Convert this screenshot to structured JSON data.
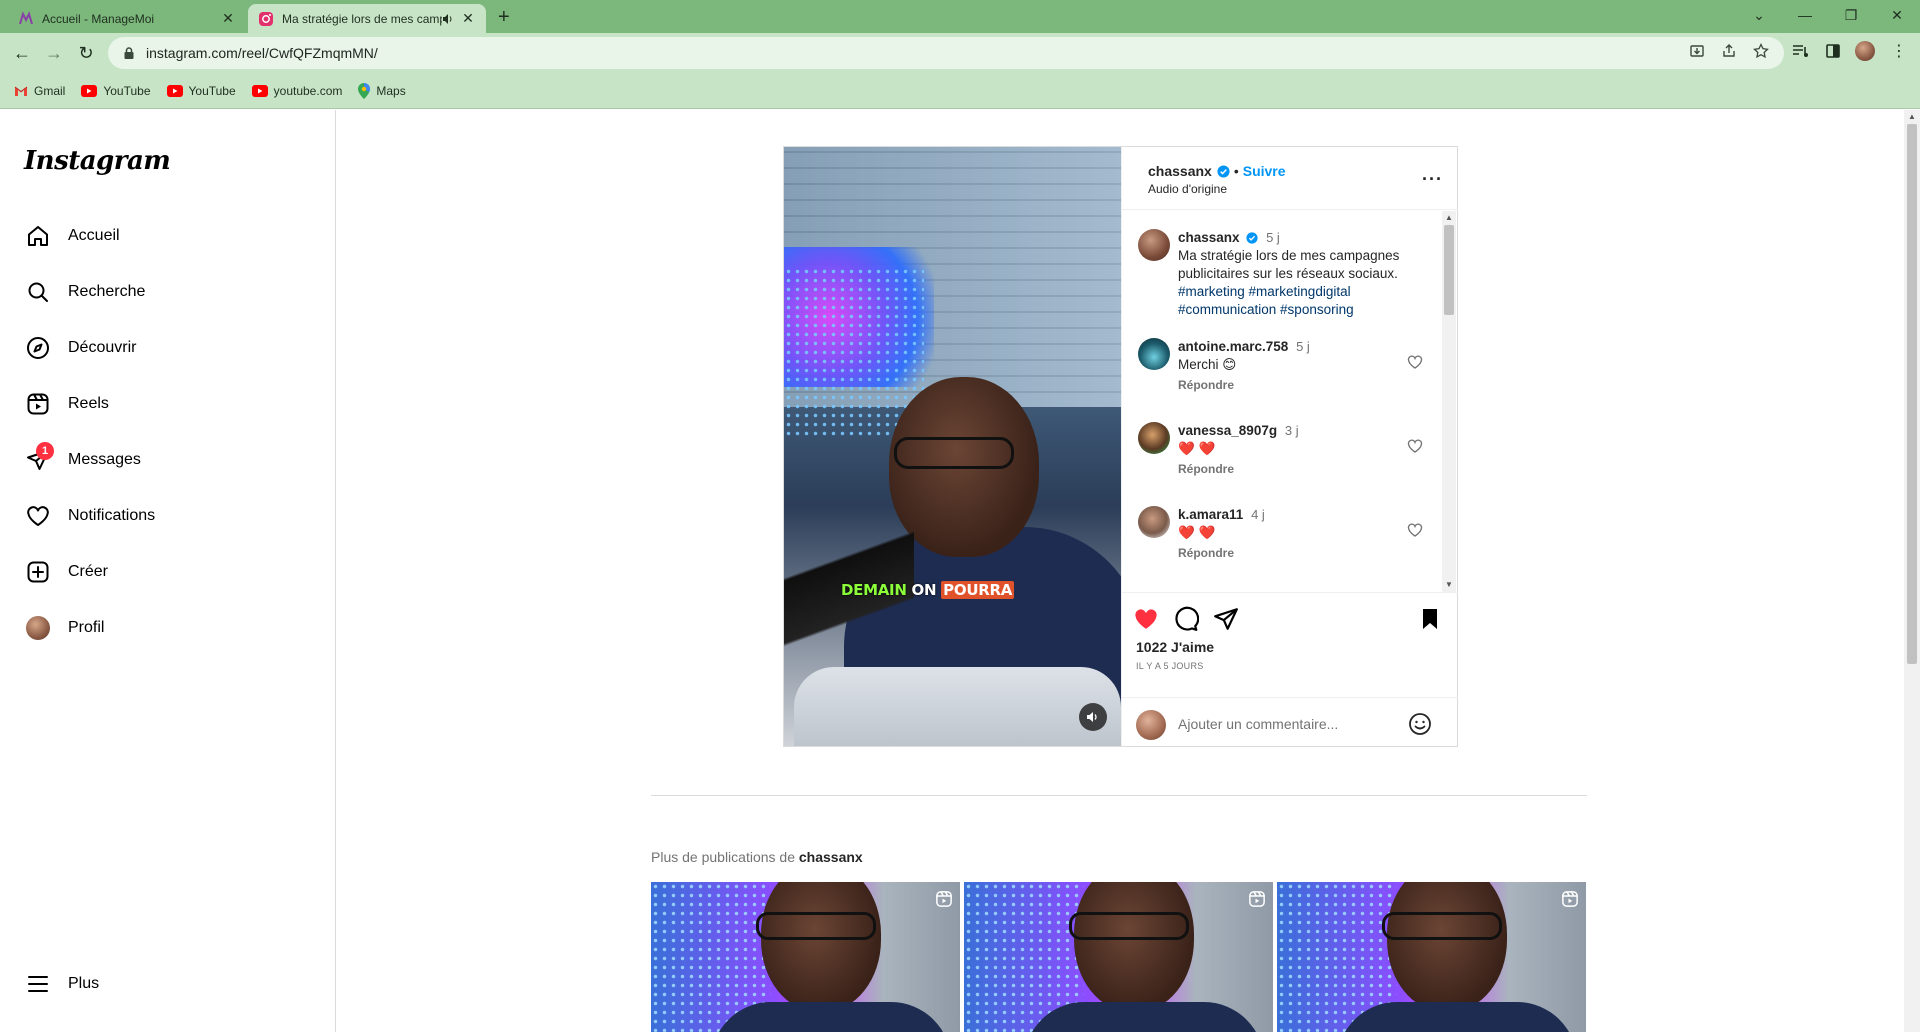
{
  "browser": {
    "tabs": [
      {
        "title": "Accueil - ManageMoi",
        "active": false
      },
      {
        "title": "Ma stratégie lors de mes campagnes",
        "active": true
      }
    ],
    "url": "instagram.com/reel/CwfQFZmqmMN/",
    "bookmarks": [
      {
        "label": "Gmail",
        "icon": "gmail-icon"
      },
      {
        "label": "YouTube",
        "icon": "youtube-icon"
      },
      {
        "label": "YouTube",
        "icon": "youtube-icon"
      },
      {
        "label": "youtube.com",
        "icon": "youtube-icon"
      },
      {
        "label": "Maps",
        "icon": "maps-icon"
      }
    ]
  },
  "sidebar": {
    "logo": "Instagram",
    "items": [
      {
        "label": "Accueil",
        "icon": "home-icon"
      },
      {
        "label": "Recherche",
        "icon": "search-icon"
      },
      {
        "label": "Découvrir",
        "icon": "compass-icon"
      },
      {
        "label": "Reels",
        "icon": "reels-icon"
      },
      {
        "label": "Messages",
        "icon": "messenger-icon",
        "badge": "1"
      },
      {
        "label": "Notifications",
        "icon": "heart-icon"
      },
      {
        "label": "Créer",
        "icon": "plus-square-icon"
      },
      {
        "label": "Profil",
        "icon": "avatar"
      }
    ],
    "more": "Plus"
  },
  "post": {
    "author": "chassanx",
    "follow": "Suivre",
    "audio": "Audio d'origine",
    "video_caption": {
      "part1": "DEMAIN",
      "part2": "ON",
      "part3": "POURRA"
    },
    "caption": {
      "username": "chassanx",
      "time": "5 j",
      "text": "Ma stratégie lors de mes campagnes publicitaires sur les réseaux sociaux.",
      "hashtags": "#marketing #marketingdigital #communication #sponsoring"
    },
    "comments": [
      {
        "username": "antoine.marc.758",
        "time": "5 j",
        "text": "Merchi 😊",
        "reply": "Répondre"
      },
      {
        "username": "vanessa_8907g",
        "time": "3 j",
        "text": "❤️ ❤️",
        "reply": "Répondre"
      },
      {
        "username": "k.amara11",
        "time": "4 j",
        "text": "❤️ ❤️",
        "reply": "Répondre"
      }
    ],
    "likes": "1022 J'aime",
    "ago": "IL Y A 5 JOURS",
    "comment_placeholder": "Ajouter un commentaire...",
    "colors": {
      "like": "#ff3040",
      "link": "#0095f6",
      "hashtag": "#00376b"
    }
  },
  "more_posts": {
    "prefix": "Plus de publications de ",
    "username": "chassanx"
  }
}
